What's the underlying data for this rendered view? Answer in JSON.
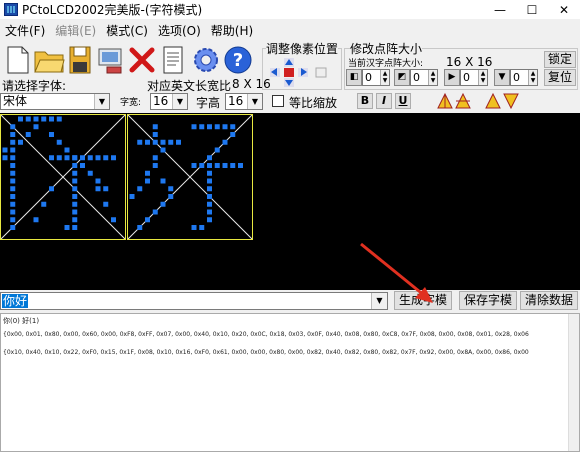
{
  "window": {
    "title": "PCtoLCD2002完美版-(字符模式)",
    "minimize": "—",
    "maximize": "☐",
    "close": "✕"
  },
  "menu": [
    {
      "label": "文件(F)",
      "enabled": true
    },
    {
      "label": "编辑(E)",
      "enabled": false
    },
    {
      "label": "模式(C)",
      "enabled": true
    },
    {
      "label": "选项(O)",
      "enabled": true
    },
    {
      "label": "帮助(H)",
      "enabled": true
    }
  ],
  "toolbar": {
    "icons": [
      "new-file-icon",
      "open-folder-icon",
      "save-disk-icon",
      "import-export-icon",
      "delete-x-icon",
      "notes-icon",
      "settings-gear-icon",
      "help-icon"
    ]
  },
  "font_panel": {
    "choose_font_label": "请选择字体:",
    "font_value": "宋体",
    "en_width_label": "对应英文长宽比",
    "ratio": "8 X 16",
    "width_label": "字宽:",
    "width_value": "16",
    "height_label": "字高",
    "height_value": "16",
    "scale_checkbox_label": "等比缩放"
  },
  "pixel_pos": {
    "title": "调整像素位置"
  },
  "resize": {
    "title": "修改点阵大小",
    "current_label": "当前汉字点阵大小:",
    "size": "16 X 16",
    "lock_button": "锁定",
    "restore_button": "复位",
    "spin_values": [
      "0",
      "0",
      "0",
      "0"
    ]
  },
  "style_buttons": {
    "bold": "B",
    "italic": "I",
    "underline": "U"
  },
  "input": {
    "text": "你好"
  },
  "buttons": {
    "generate": "生成字模",
    "save": "保存字模",
    "clear": "清除数据"
  },
  "output": {
    "header": "你(0) 好(1)",
    "line1": "{0x00, 0x01, 0x80, 0x00, 0x60, 0x00, 0xF8, 0xFF, 0x07, 0x00, 0x40, 0x10, 0x20, 0x0C, 0x18, 0x03, 0x0F, 0x40, 0x08, 0x80, 0xC8, 0x7F, 0x08, 0x00, 0x08, 0x01, 0x28, 0x06",
    "line2": "{0x10, 0x40, 0x10, 0x22, 0xF0, 0x15, 0x1F, 0x08, 0x10, 0x16, 0xF0, 0x61, 0x00, 0x00, 0x80, 0x00, 0x82, 0x40, 0x82, 0x80, 0x82, 0x7F, 0x92, 0x00, 0x8A, 0x00, 0x86, 0x00"
  },
  "accent_colors": {
    "pixel": "#1e78f0",
    "grid": "#e8e840",
    "annotation_arrow": "#e03020"
  }
}
